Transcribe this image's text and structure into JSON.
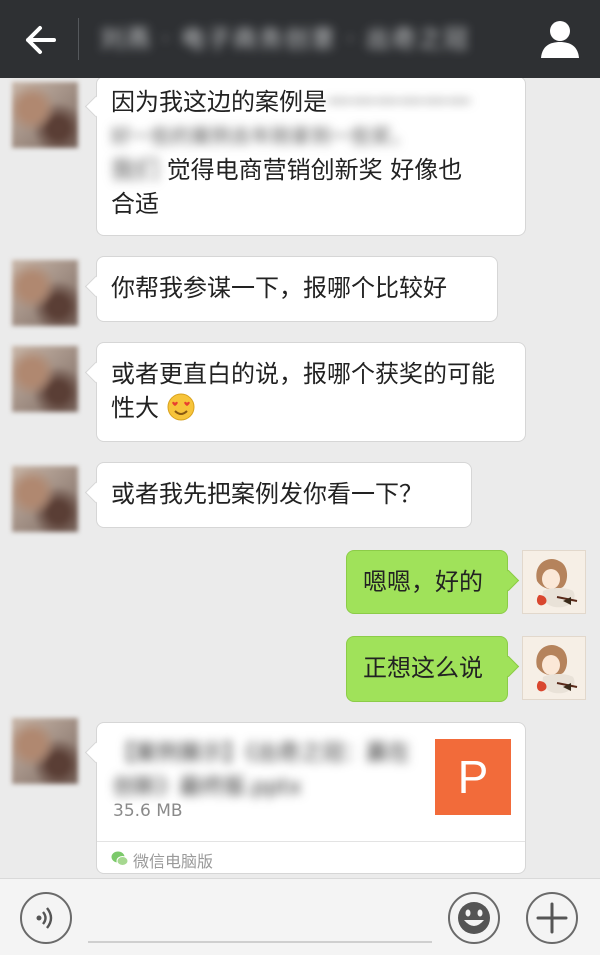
{
  "header": {
    "title": "刘燕 · 电子商务创意 · 出奇之冠",
    "back_icon": "back-arrow-icon",
    "profile_icon": "person-icon"
  },
  "messages": [
    {
      "side": "left",
      "line1_visible": "因为我这边的案例是",
      "line1_hidden": "一一一一一一",
      "line2_hidden": "好一些的案例去年刚拿到一些奖，",
      "line3_hidden": "我们",
      "line3_visible": "觉得电商营销创新奖  好像也",
      "line4": "合适"
    },
    {
      "side": "left",
      "text": "你帮我参谋一下，报哪个比较好"
    },
    {
      "side": "left",
      "text": "或者更直白的说，报哪个获奖的可能性大",
      "emoji": "heart-eyes-emoji"
    },
    {
      "side": "left",
      "text": "或者我先把案例发你看一下？"
    },
    {
      "side": "right",
      "text": "嗯嗯，好的"
    },
    {
      "side": "right",
      "text": "正想这么说"
    }
  ],
  "file": {
    "name": "【案例展示】《出奇之冠：赢在创新》最终版.pptx",
    "size": "35.6 MB",
    "icon_letter": "P",
    "icon_color": "#f26b3a",
    "source": "微信电脑版"
  },
  "bottom_bar": {
    "voice_icon": "voice-icon",
    "emoji_icon": "smiley-icon",
    "plus_icon": "plus-icon"
  },
  "colors": {
    "header_bg": "#2e3033",
    "chat_bg": "#ebebeb",
    "sent_bubble": "#a0e25a",
    "received_bubble": "#ffffff"
  }
}
